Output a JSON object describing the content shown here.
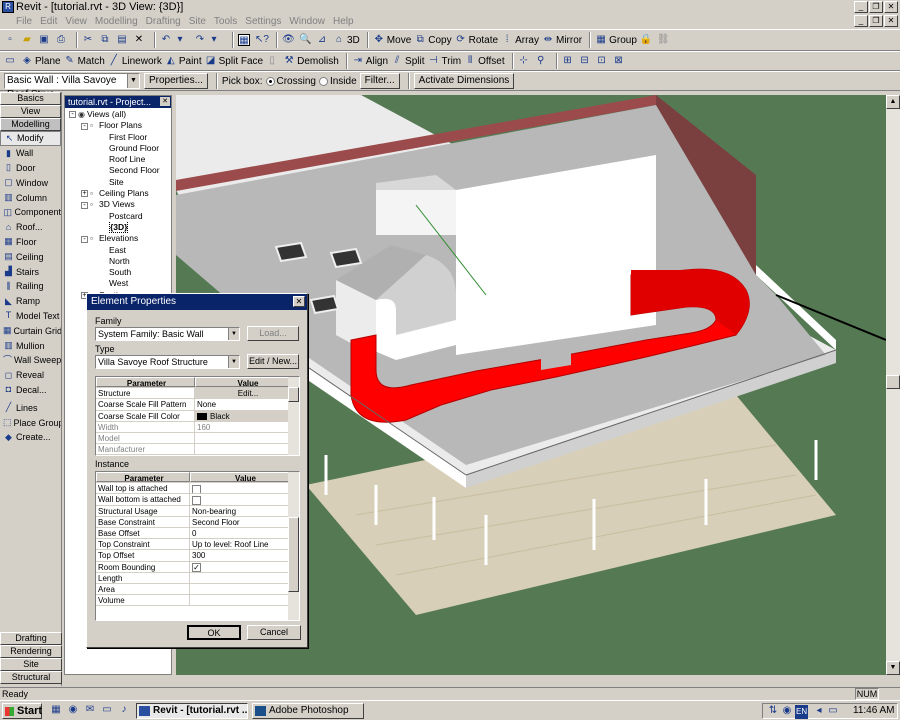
{
  "window": {
    "title": "Revit - [tutorial.rvt - 3D View: {3D}]",
    "icon_text": "R",
    "buttons": [
      "_",
      "❐",
      "✕"
    ]
  },
  "menu": [
    "File",
    "Edit",
    "View",
    "Modelling",
    "Drafting",
    "Site",
    "Tools",
    "Settings",
    "Window",
    "Help"
  ],
  "toolbar1": {
    "move": "Move",
    "copy": "Copy",
    "rotate": "Rotate",
    "array": "Array",
    "mirror": "Mirror",
    "group": "Group",
    "view3d": "3D"
  },
  "toolbar2": {
    "plane": "Plane",
    "match": "Match",
    "linework": "Linework",
    "paint": "Paint",
    "split_face": "Split Face",
    "demolish": "Demolish",
    "align": "Align",
    "split": "Split",
    "trim": "Trim",
    "offset": "Offset"
  },
  "toolbar3": {
    "type_selector": "Basic Wall : Villa Savoye Roof Struc",
    "properties": "Properties...",
    "pick_box_label": "Pick box:",
    "crossing": "Crossing",
    "inside": "Inside",
    "filter": "Filter...",
    "activate_dimensions": "Activate Dimensions"
  },
  "design_bar": {
    "tabs_top": [
      "Basics",
      "View",
      "Modelling"
    ],
    "items": [
      "Modify",
      "Wall",
      "Door",
      "Window",
      "Column",
      "Component",
      "Roof...",
      "Floor",
      "Ceiling",
      "Stairs",
      "Railing",
      "Ramp",
      "Model Text",
      "Curtain Grid",
      "Mullion",
      "Wall Sweep",
      "Reveal",
      "Decal...",
      "Lines",
      "Place Group",
      "Create..."
    ],
    "tabs_bottom": [
      "Drafting",
      "Rendering",
      "Site",
      "Structural"
    ]
  },
  "project_browser": {
    "title": "tutorial.rvt - Project...",
    "tree": [
      {
        "label": "Views (all)",
        "level": 0,
        "pm": "-"
      },
      {
        "label": "Floor Plans",
        "level": 1,
        "pm": "-"
      },
      {
        "label": "First Floor",
        "level": 2
      },
      {
        "label": "Ground Floor",
        "level": 2
      },
      {
        "label": "Roof Line",
        "level": 2
      },
      {
        "label": "Second Floor",
        "level": 2
      },
      {
        "label": "Site",
        "level": 2
      },
      {
        "label": "Ceiling Plans",
        "level": 1,
        "pm": "+"
      },
      {
        "label": "3D Views",
        "level": 1,
        "pm": "-"
      },
      {
        "label": "Postcard",
        "level": 2
      },
      {
        "label": "{3D}",
        "level": 2,
        "bold": true
      },
      {
        "label": "Elevations",
        "level": 1,
        "pm": "-"
      },
      {
        "label": "East",
        "level": 2
      },
      {
        "label": "North",
        "level": 2
      },
      {
        "label": "South",
        "level": 2
      },
      {
        "label": "West",
        "level": 2
      },
      {
        "label": "Sections",
        "level": 1,
        "pm": "+"
      }
    ]
  },
  "dialog": {
    "title": "Element Properties",
    "family_label": "Family",
    "family_value": "System Family: Basic Wall",
    "load": "Load...",
    "type_label": "Type",
    "type_value": "Villa Savoye Roof Structure",
    "edit_new": "Edit / New...",
    "type_header": {
      "param": "Parameter",
      "value": "Value"
    },
    "type_params": [
      {
        "p": "Structure",
        "v": "Edit..."
      },
      {
        "p": "Coarse Scale Fill Pattern",
        "v": "None"
      },
      {
        "p": "Coarse Scale Fill Color",
        "v": "Black"
      },
      {
        "p": "Width",
        "v": "160"
      },
      {
        "p": "Model",
        "v": ""
      },
      {
        "p": "Manufacturer",
        "v": ""
      }
    ],
    "instance_label": "Instance",
    "inst_header": {
      "param": "Parameter",
      "value": "Value"
    },
    "inst_params": [
      {
        "p": "Wall top is attached",
        "v": "",
        "chk": false
      },
      {
        "p": "Wall bottom is attached",
        "v": "",
        "chk": false
      },
      {
        "p": "Structural Usage",
        "v": "Non-bearing"
      },
      {
        "p": "Base Constraint",
        "v": "Second Floor"
      },
      {
        "p": "Base Offset",
        "v": "0"
      },
      {
        "p": "Top Constraint",
        "v": "Up to level: Roof Line"
      },
      {
        "p": "Top Offset",
        "v": "300"
      },
      {
        "p": "Room Bounding",
        "v": "",
        "chk": true
      },
      {
        "p": "Length",
        "v": ""
      },
      {
        "p": "Area",
        "v": ""
      },
      {
        "p": "Volume",
        "v": ""
      }
    ],
    "ok": "OK",
    "cancel": "Cancel"
  },
  "status": {
    "text": "Ready",
    "num": "NUM"
  },
  "taskbar": {
    "start": "Start",
    "tasks": [
      "Revit - [tutorial.rvt ...",
      "Adobe Photoshop"
    ],
    "tray_lang": "EN",
    "clock": "11:46 AM"
  },
  "colors": {
    "selected_wall": "#ff0000",
    "viewport_bg": "#557a53",
    "titlebar": "#0a246a"
  }
}
